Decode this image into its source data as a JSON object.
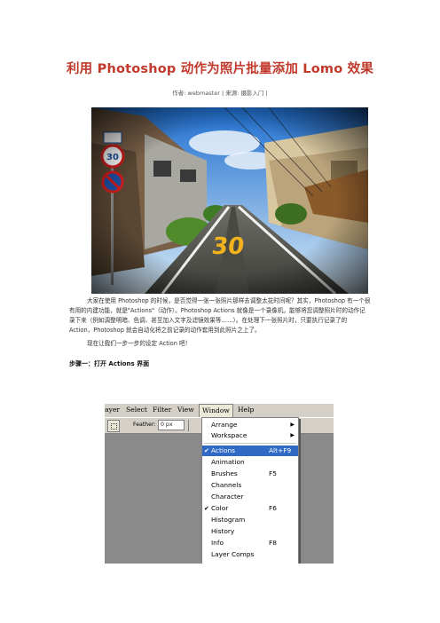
{
  "article": {
    "title": "利用 Photoshop 动作为照片批量添加 Lomo 效果",
    "meta": "作者: webmaster | 来源: 摄影入门 |",
    "photo_caption_number": "30",
    "intro": "大家在使用 Photoshop 的时候，是否觉得一张一张照片那样去调整太花时间呢？其实，Photoshop 有一个很有用的内建功能，就是\"Actions\"（动作）。Photoshop Actions 就像是一个录像机，能够将您调整照片时的动作记录下来（例如调整明暗、色调、甚至加入文字及滤镜效果等……）。在处理下一张照片时，只要执行记录了的 Action，Photoshop 就会自动化将之前记录的动作套用到此照片之上了。",
    "lead": "现在让我们一步一步的设定 Action 吧！",
    "step1": "步骤一：打开 Actions 界面"
  },
  "photoshop": {
    "menubar": [
      "ayer",
      "Select",
      "Filter",
      "View",
      "Window",
      "Help"
    ],
    "active_menu": "Window",
    "feather_label": "Feather:",
    "feather_value": "0 px",
    "window_menu": [
      {
        "label": "Arrange",
        "submenu": true
      },
      {
        "label": "Workspace",
        "submenu": true
      },
      {
        "label": "Actions",
        "shortcut": "Alt+F9",
        "checked": true,
        "highlighted": true
      },
      {
        "label": "Animation"
      },
      {
        "label": "Brushes",
        "shortcut": "F5"
      },
      {
        "label": "Channels"
      },
      {
        "label": "Character"
      },
      {
        "label": "Color",
        "shortcut": "F6",
        "checked": true
      },
      {
        "label": "Histogram"
      },
      {
        "label": "History"
      },
      {
        "label": "Info",
        "shortcut": "F8"
      },
      {
        "label": "Layer Comps"
      }
    ]
  }
}
